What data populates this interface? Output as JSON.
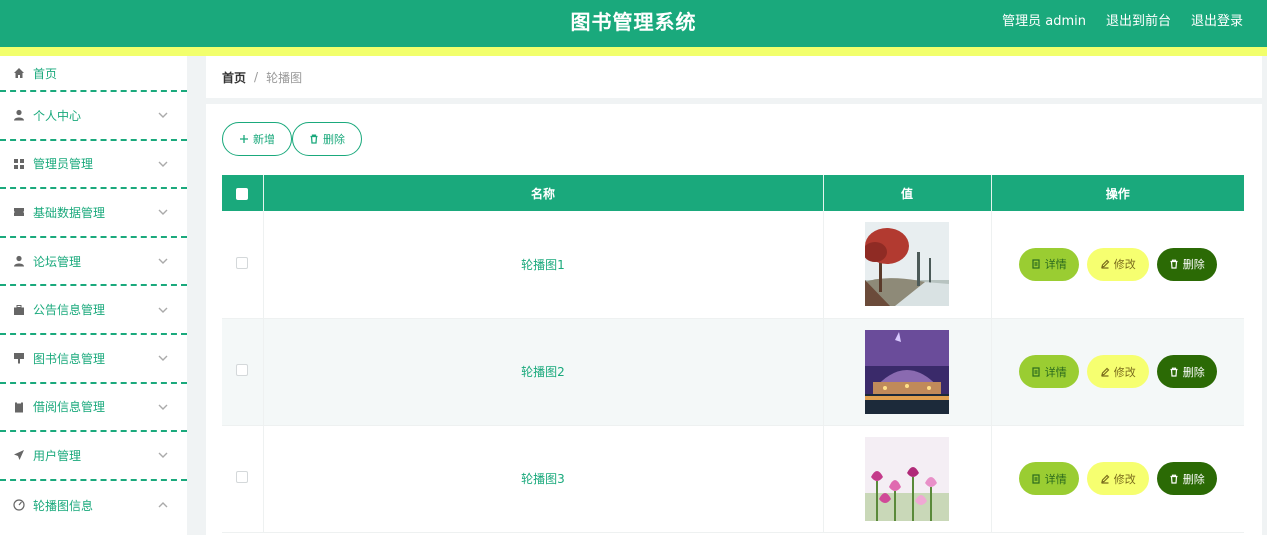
{
  "header": {
    "title": "图书管理系统",
    "admin_label": "管理员 admin",
    "front_link": "退出到前台",
    "logout_link": "退出登录"
  },
  "sidebar": {
    "items": [
      {
        "label": "首页",
        "icon": "home-icon"
      },
      {
        "label": "个人中心",
        "icon": "user-icon"
      },
      {
        "label": "管理员管理",
        "icon": "grid-icon"
      },
      {
        "label": "基础数据管理",
        "icon": "ticket-icon"
      },
      {
        "label": "论坛管理",
        "icon": "user-icon"
      },
      {
        "label": "公告信息管理",
        "icon": "briefcase-icon"
      },
      {
        "label": "图书信息管理",
        "icon": "sign-icon"
      },
      {
        "label": "借阅信息管理",
        "icon": "clipboard-icon"
      },
      {
        "label": "用户管理",
        "icon": "send-icon"
      },
      {
        "label": "轮播图信息",
        "icon": "dashboard-icon"
      }
    ]
  },
  "breadcrumb": {
    "home": "首页",
    "separator": "/",
    "current": "轮播图"
  },
  "toolbar": {
    "add_label": "新增",
    "delete_label": "删除"
  },
  "table": {
    "columns": [
      "名称",
      "值",
      "操作"
    ],
    "rows": [
      {
        "name": "轮播图1",
        "image": "tree-scene"
      },
      {
        "name": "轮播图2",
        "image": "night-building"
      },
      {
        "name": "轮播图3",
        "image": "tulips"
      }
    ],
    "actions": {
      "detail": "详情",
      "edit": "修改",
      "delete": "删除"
    }
  },
  "colors": {
    "primary": "#1aa97c",
    "stripe": "#f2ff6c",
    "detail_button": "#9acd32",
    "edit_button": "#f6ff70",
    "delete_button": "#2b6a05"
  }
}
